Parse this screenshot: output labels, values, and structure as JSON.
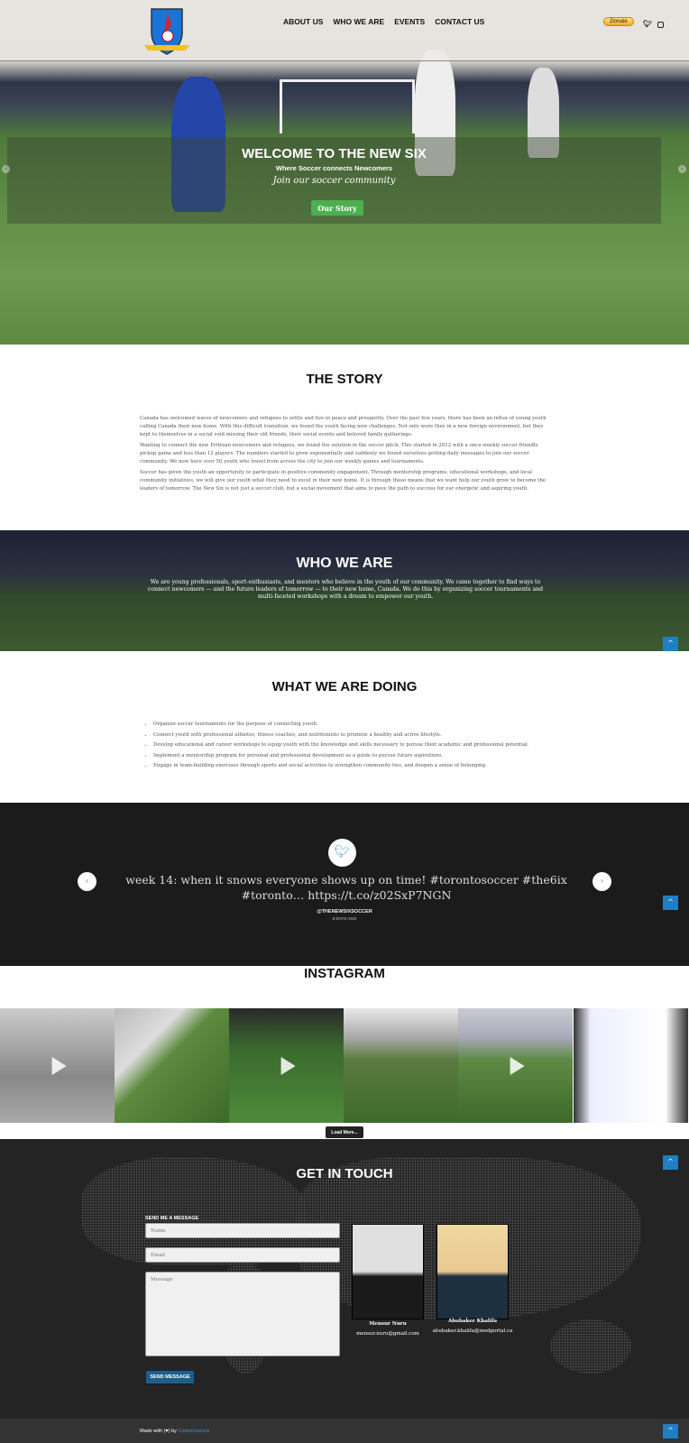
{
  "header": {
    "nav": [
      "ABOUT US",
      "WHO WE ARE",
      "EVENTS",
      "CONTACT US"
    ],
    "donate_label": "Donate",
    "logo_text": "THE NEW SIX",
    "social": [
      "twitter-icon",
      "instagram-icon"
    ]
  },
  "hero": {
    "title": "WELCOME TO THE NEW SIX",
    "subtitle": "Where Soccer connects Newcomers",
    "tagline": "Join our soccer community",
    "button": "Our Story"
  },
  "story": {
    "title": "THE STORY",
    "paragraphs": [
      "Canada has welcomed waves of newcomers and refugees to settle and live in peace and prosperity. Over the past few years, there has been an influx of young youth calling Canada their new home. With this difficult transition, we found the youth facing new challenges. Not only were they in a new foreign environment, but they kept to themselves in a social void missing their old friends, their social events and beloved family gatherings.",
      "Wanting to connect the new Eritrean newcomers and refugees, we found the solution in the soccer pitch. This started in 2012 with a once-weekly soccer friendly pickup game and less than 12 players. The numbers started to grow exponentially and suddenly we found ourselves getting daily messages to join our soccer community. We now have over 50 youth who travel from across the city to join our weekly games and tournaments.",
      "Soccer has given the youth an opportunity to participate in positive community engagement. Through mentorship programs, educational workshops, and local community initiatives, we will give our youth what they need to excel in their new home. It is through these means that we want help our youth grow to become the leaders of tomorrow. The New Six is not just a soccer club, but a social movement that aims to pave the path to success for our energetic and aspiring youth."
    ]
  },
  "who": {
    "title": "WHO WE ARE",
    "text": "We are young professionals, sport-enthusiasts, and mentors who believe in the youth of our community. We came together to find ways to connect newcomers — and the future leaders of tomorrow — to their new home, Canada. We do this by organizing soccer tournaments and multi-faceted workshops with a dream to empower our youth."
  },
  "doing": {
    "title": "WHAT WE ARE DOING",
    "items": [
      "Organize soccer tournaments for the purpose of connecting youth.",
      "Connect youth with professional athletes, fitness coaches, and nutritionists to promote a healthy and active lifestyle.",
      "Develop educational and career workshops to equip youth with the knowledge and skills necessary to pursue their academic and professional potential.",
      "Implement a mentorship program for personal and professional development as a guide to pursue future aspirations.",
      "Engage in team-building exercises through sports and social activities to strengthen community ties, and deepen a sense of belonging."
    ]
  },
  "twitter": {
    "tweet": "week 14: when it snows everyone shows up on time! #torontosoccer #the6ix #toronto… https://t.co/z02SxP7NGN",
    "handle": "@THENEWSIXSOCCER",
    "ago": "6 DAYS AGO"
  },
  "instagram": {
    "title": "INSTAGRAM",
    "load_more": "Load More..."
  },
  "contact": {
    "title": "GET IN TOUCH",
    "form_label": "SEND ME A MESSAGE",
    "name_placeholder": "Name",
    "email_placeholder": "Email",
    "message_placeholder": "Message",
    "send": "SEND MESSAGE",
    "people": [
      {
        "name": "Mensur Nuru",
        "email": "mensur.nuru@gmail.com"
      },
      {
        "name": "Abubaker Khalifa",
        "email": "abubaker.khalifa@medportal.ca"
      }
    ]
  },
  "footer": {
    "made_with": "Made with (♥) by",
    "author": "Codemaximus"
  },
  "colors": {
    "accent": "#1f7fc0",
    "green_button": "#4caf50",
    "dark": "#1b1b1b"
  }
}
